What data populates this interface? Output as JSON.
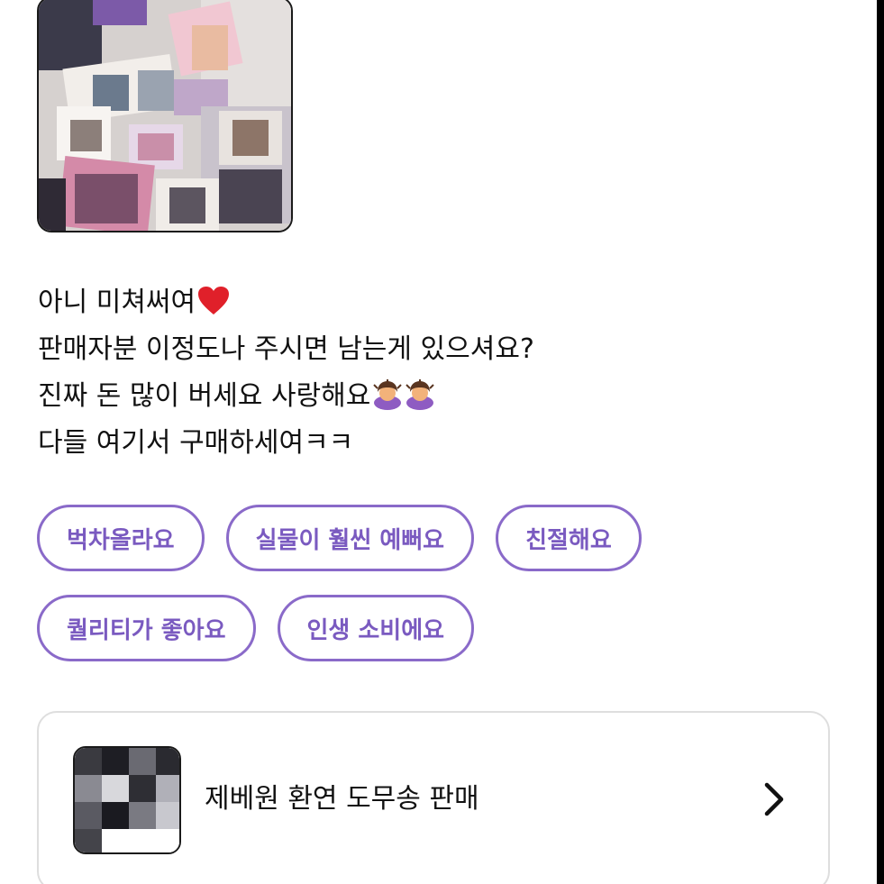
{
  "review": {
    "lines": [
      "아니 미쳐써여",
      "판매자분 이정도나 주시면 남는게 있으셔요?",
      "진짜 돈 많이 버세요 사랑해요",
      "다들 여기서 구매하세여ㅋㅋ"
    ]
  },
  "tags": {
    "row1": [
      "벅차올라요",
      "실물이 훨씬 예뻐요",
      "친절해요"
    ],
    "row2": [
      "퀄리티가 좋아요",
      "인생 소비에요"
    ]
  },
  "product": {
    "title": "제베원 환연 도무송 판매"
  },
  "icons": {
    "heart": "red-heart-icon",
    "bow": "person-bowing-icon",
    "chevron": "chevron-right-icon"
  },
  "colors": {
    "accent": "#8a6ac9",
    "accent_text": "#7a5ac0",
    "card_border": "#dedede"
  }
}
